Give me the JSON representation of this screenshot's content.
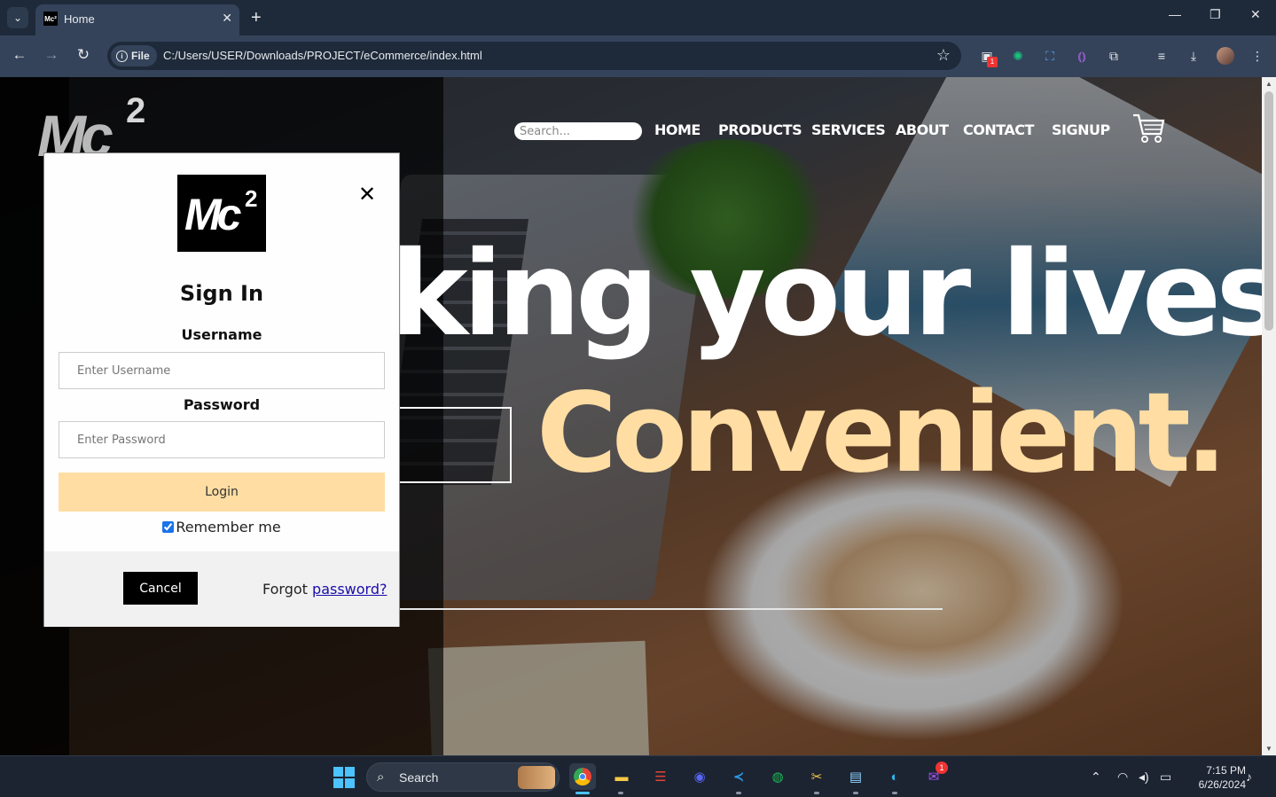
{
  "browser": {
    "tab_title": "Home",
    "tab_favicon_text": "Mc²",
    "new_tab_symbol": "+",
    "close_symbol": "✕",
    "address_chip": "File",
    "url": "C:/Users/USER/Downloads/PROJECT/eCommerce/index.html",
    "extension_badge": "1",
    "window_controls": [
      "—",
      "❐",
      "✕"
    ]
  },
  "site": {
    "logo": {
      "main": "Mc",
      "superscript": "2"
    },
    "search_placeholder": "Search...",
    "nav": [
      "HOME",
      "PRODUCTS",
      "SERVICES",
      "ABOUT",
      "CONTACT",
      "SIGNUP"
    ],
    "hero_line1": "king your lives",
    "hero_line2": "Convenient."
  },
  "modal": {
    "logo": {
      "main": "Mc",
      "superscript": "2"
    },
    "close_symbol": "✕",
    "title": "Sign In",
    "username_label": "Username",
    "username_placeholder": "Enter Username",
    "password_label": "Password",
    "password_placeholder": "Enter Password",
    "login_label": "Login",
    "remember_label": "Remember me",
    "remember_checked": true,
    "cancel_label": "Cancel",
    "forgot_text": "Forgot ",
    "forgot_link": "password?"
  },
  "taskbar": {
    "search_label": "Search",
    "messenger_badge": "1",
    "time": "7:15 PM",
    "date": "6/26/2024"
  },
  "colors": {
    "accent_yellow": "#ffdda3",
    "browser_frame": "#1e2a3a",
    "toolbar": "#34435a",
    "windows_blue": "#4cc2ff"
  }
}
